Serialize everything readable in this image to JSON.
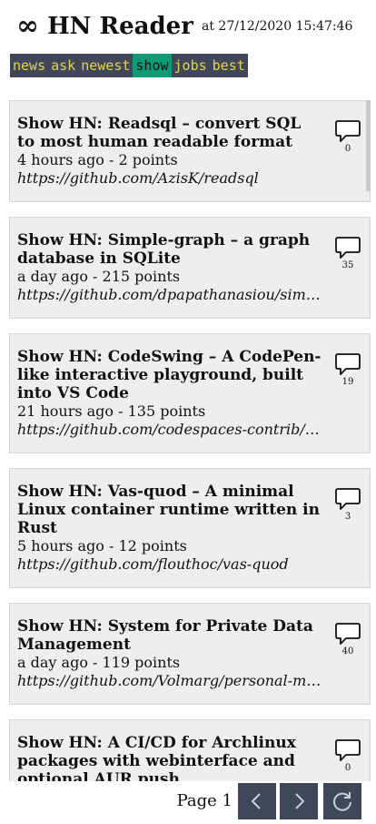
{
  "header": {
    "logo": "∞",
    "title": "HN Reader",
    "timestamp": "at 27/12/2020 15:47:46"
  },
  "nav": {
    "items": [
      {
        "label": "news"
      },
      {
        "label": "ask"
      },
      {
        "label": "newest"
      },
      {
        "label": "show"
      },
      {
        "label": "jobs"
      },
      {
        "label": "best"
      }
    ],
    "active": "show"
  },
  "stories": [
    {
      "title": "Show HN: Readsql – convert SQL to most human readable format",
      "meta": "4 hours ago - 2 points",
      "url": "https://github.com/AzisK/readsql",
      "comments": "0"
    },
    {
      "title": "Show HN: Simple-graph – a graph database in SQLite",
      "meta": "a day ago - 215 points",
      "url": "https://github.com/dpapathanasiou/simple-graph",
      "comments": "35"
    },
    {
      "title": "Show HN: CodeSwing – A CodePen-like interactive playground, built into VS Code",
      "meta": "21 hours ago - 135 points",
      "url": "https://github.com/codespaces-contrib/codeswing",
      "comments": "19"
    },
    {
      "title": "Show HN: Vas-quod – A minimal Linux container runtime written in Rust",
      "meta": "5 hours ago - 12 points",
      "url": "https://github.com/flouthoc/vas-quod",
      "comments": "3"
    },
    {
      "title": "Show HN: System for Private Data Management",
      "meta": "a day ago - 119 points",
      "url": "https://github.com/Volmarg/personal-management-system",
      "comments": "40"
    },
    {
      "title": "Show HN: A CI/CD for Archlinux packages with webinterface and optional AUR push",
      "meta": "",
      "url": "",
      "comments": "0"
    }
  ],
  "footer": {
    "page_label": "Page 1"
  },
  "icons": {
    "logo": "infinity-icon",
    "comments": "speech-bubble-icon",
    "prev": "chevron-left-icon",
    "next": "chevron-right-icon",
    "reload": "reload-icon"
  },
  "colors": {
    "nav_bg": "#3f4758",
    "nav_text": "#e6d34f",
    "nav_active": "#0f9a76",
    "card_bg": "#eeeeee"
  }
}
